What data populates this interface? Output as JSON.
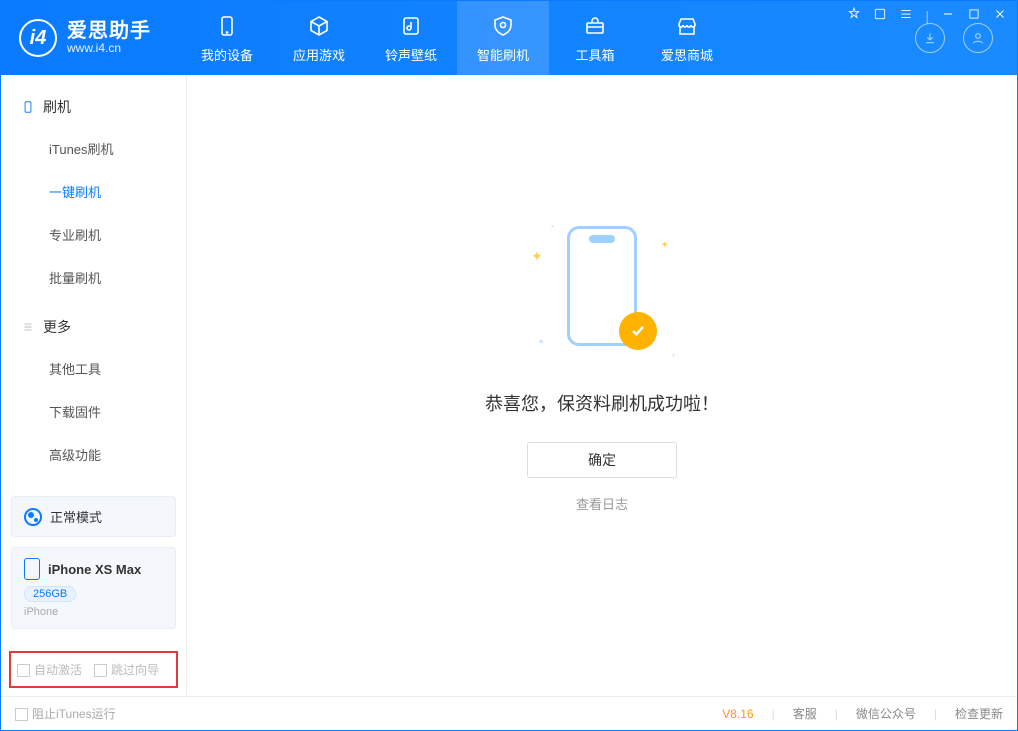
{
  "logo": {
    "appName": "爱思助手",
    "site": "www.i4.cn"
  },
  "tabs": [
    {
      "label": "我的设备"
    },
    {
      "label": "应用游戏"
    },
    {
      "label": "铃声壁纸"
    },
    {
      "label": "智能刷机"
    },
    {
      "label": "工具箱"
    },
    {
      "label": "爱思商城"
    }
  ],
  "sidebar": {
    "group1": {
      "header": "刷机",
      "items": [
        "iTunes刷机",
        "一键刷机",
        "专业刷机",
        "批量刷机"
      ]
    },
    "group2": {
      "header": "更多",
      "items": [
        "其他工具",
        "下载固件",
        "高级功能"
      ]
    }
  },
  "deviceMode": {
    "label": "正常模式"
  },
  "device": {
    "name": "iPhone XS Max",
    "capacity": "256GB",
    "type": "iPhone"
  },
  "opts": {
    "opt1": "自动激活",
    "opt2": "跳过向导"
  },
  "main": {
    "successMsg": "恭喜您，保资料刷机成功啦！",
    "okBtn": "确定",
    "viewLog": "查看日志"
  },
  "status": {
    "blockItunes": "阻止iTunes运行",
    "version": "V8.16",
    "support": "客服",
    "wechat": "微信公众号",
    "update": "检查更新"
  }
}
